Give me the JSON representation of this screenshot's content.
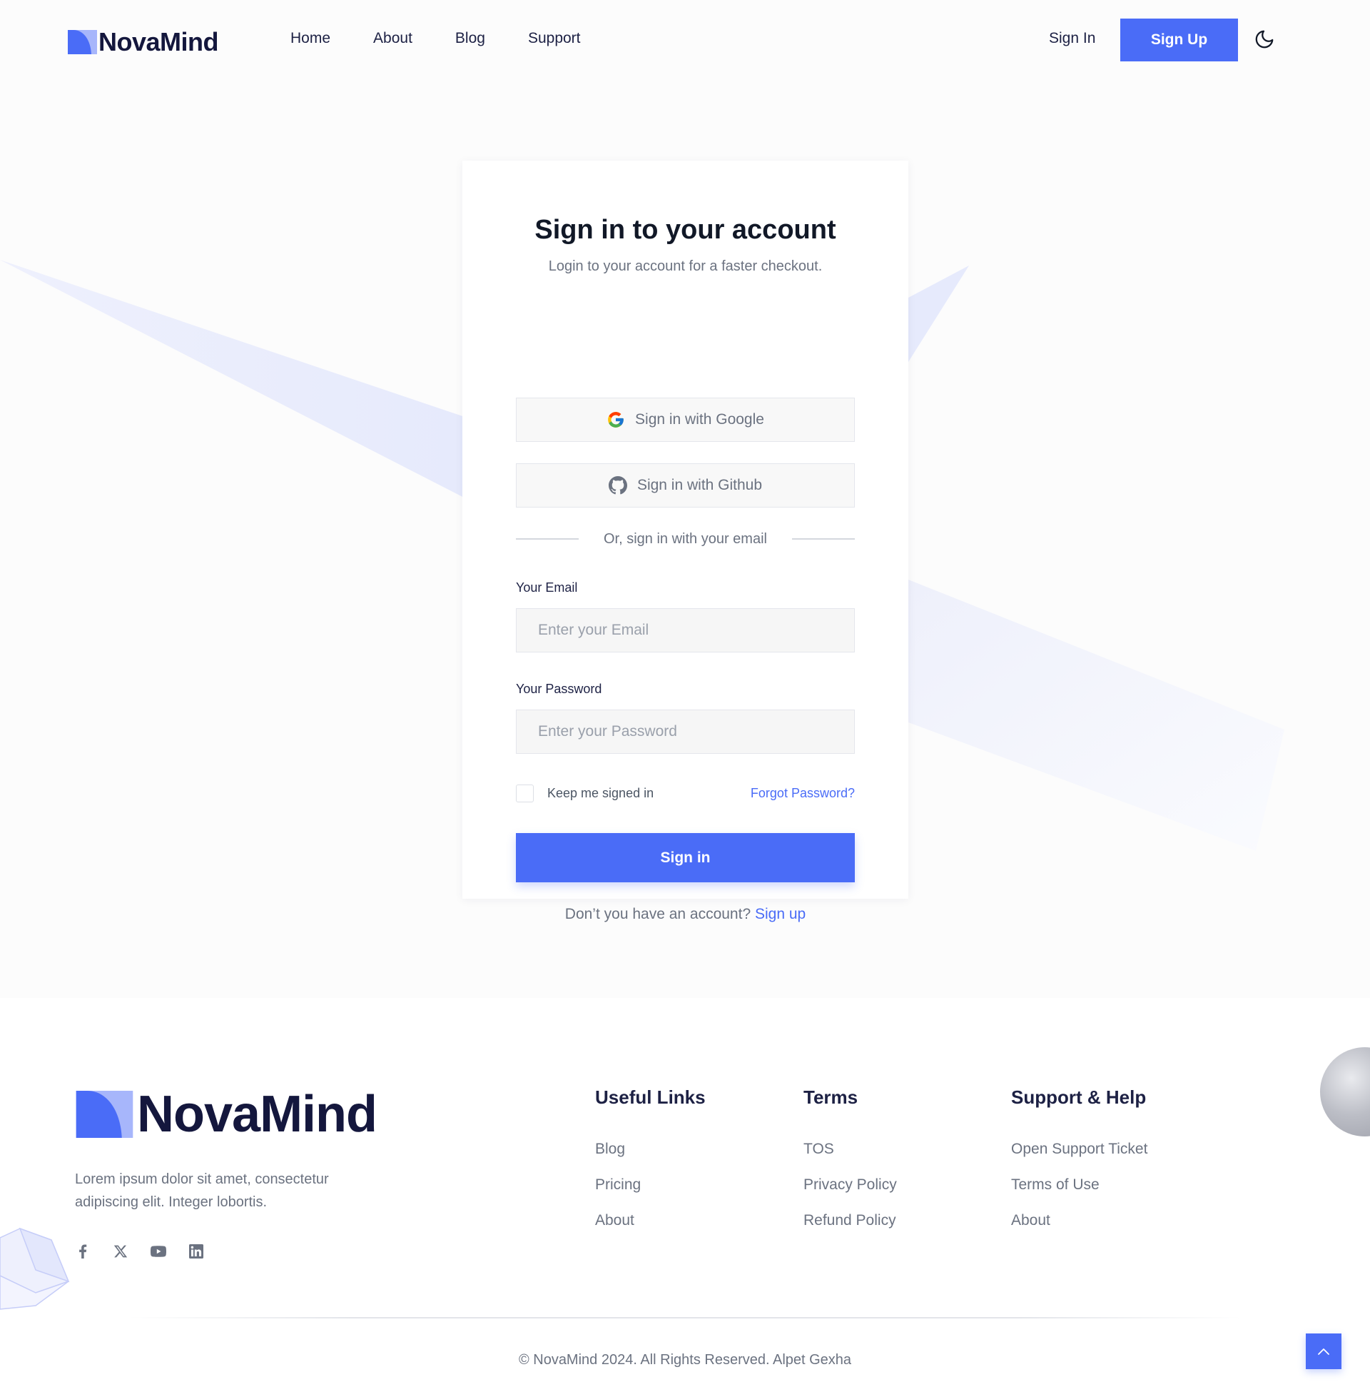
{
  "brand": {
    "name": "NovaMind",
    "primary_color": "#4a6cf7",
    "dark_color": "#14173d",
    "logo_icon": "novamind-logo-mark"
  },
  "header": {
    "nav": {
      "home": "Home",
      "about": "About",
      "blog": "Blog",
      "support": "Support"
    },
    "sign_in": "Sign In",
    "sign_up": "Sign Up",
    "theme_icon": "moon-icon"
  },
  "form": {
    "title": "Sign in to your account",
    "subtitle": "Login to your account for a faster checkout.",
    "google_button": "Sign in with Google",
    "github_button": "Sign in with Github",
    "divider_text": "Or, sign in with your email",
    "email_label": "Your Email",
    "email_placeholder": "Enter your Email",
    "email_value": "",
    "password_label": "Your Password",
    "password_placeholder": "Enter your Password",
    "password_value": "",
    "remember_label": "Keep me signed in",
    "remember_checked": false,
    "forgot_link": "Forgot Password?",
    "submit_label": "Sign in",
    "no_account_text": "Don’t you have an account?",
    "signup_link": "Sign up"
  },
  "footer": {
    "description": "Lorem ipsum dolor sit amet, consectetur adipiscing elit. Integer lobortis.",
    "socials": [
      "facebook-icon",
      "x-icon",
      "youtube-icon",
      "linkedin-icon"
    ],
    "useful_links": {
      "heading": "Useful Links",
      "items": [
        "Blog",
        "Pricing",
        "About"
      ]
    },
    "terms": {
      "heading": "Terms",
      "items": [
        "TOS",
        "Privacy Policy",
        "Refund Policy"
      ]
    },
    "support": {
      "heading": "Support & Help",
      "items": [
        "Open Support Ticket",
        "Terms of Use",
        "About"
      ]
    },
    "copyright": "© NovaMind 2024. All Rights Reserved. Alpet Gexha"
  }
}
